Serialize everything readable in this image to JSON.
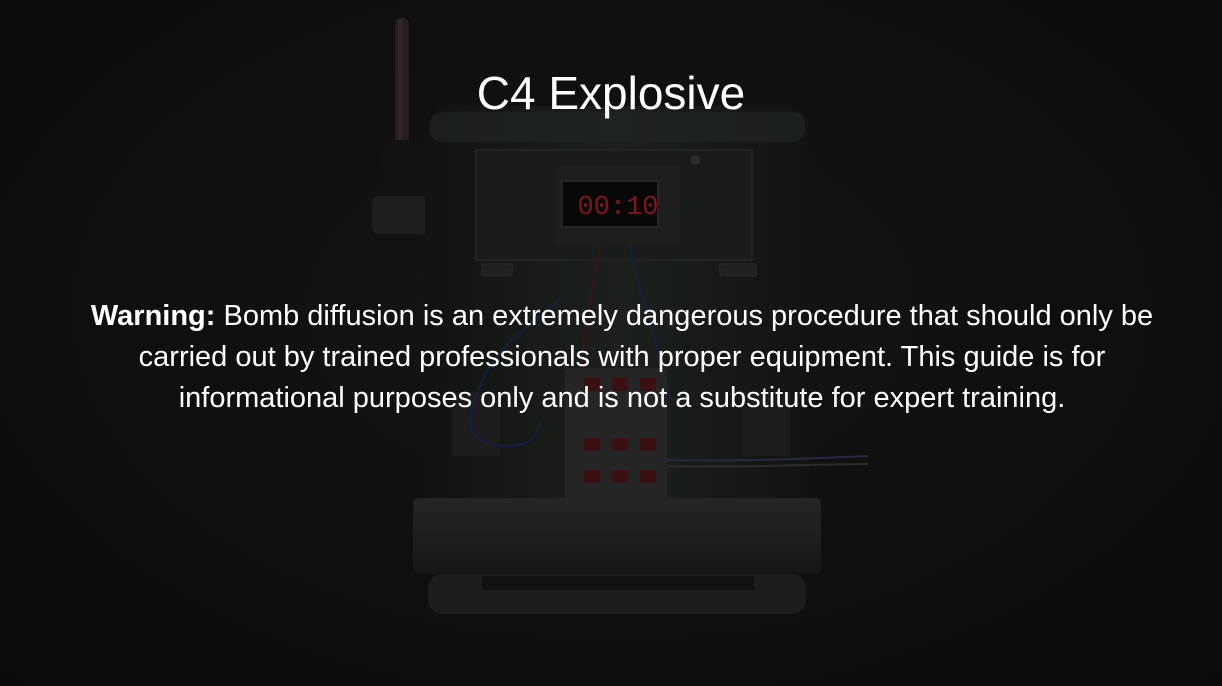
{
  "page": {
    "title": "C4 Explosive",
    "warning_label": "Warning:",
    "warning_text": " Bomb diffusion is an extremely dangerous procedure that should only be carried out by trained professionals with proper equipment. This guide is for informational purposes only and is not a substitute for expert training."
  },
  "device": {
    "timer_display": "00:10",
    "timer_color": "#c0272d",
    "body_color": "#2b332c"
  }
}
